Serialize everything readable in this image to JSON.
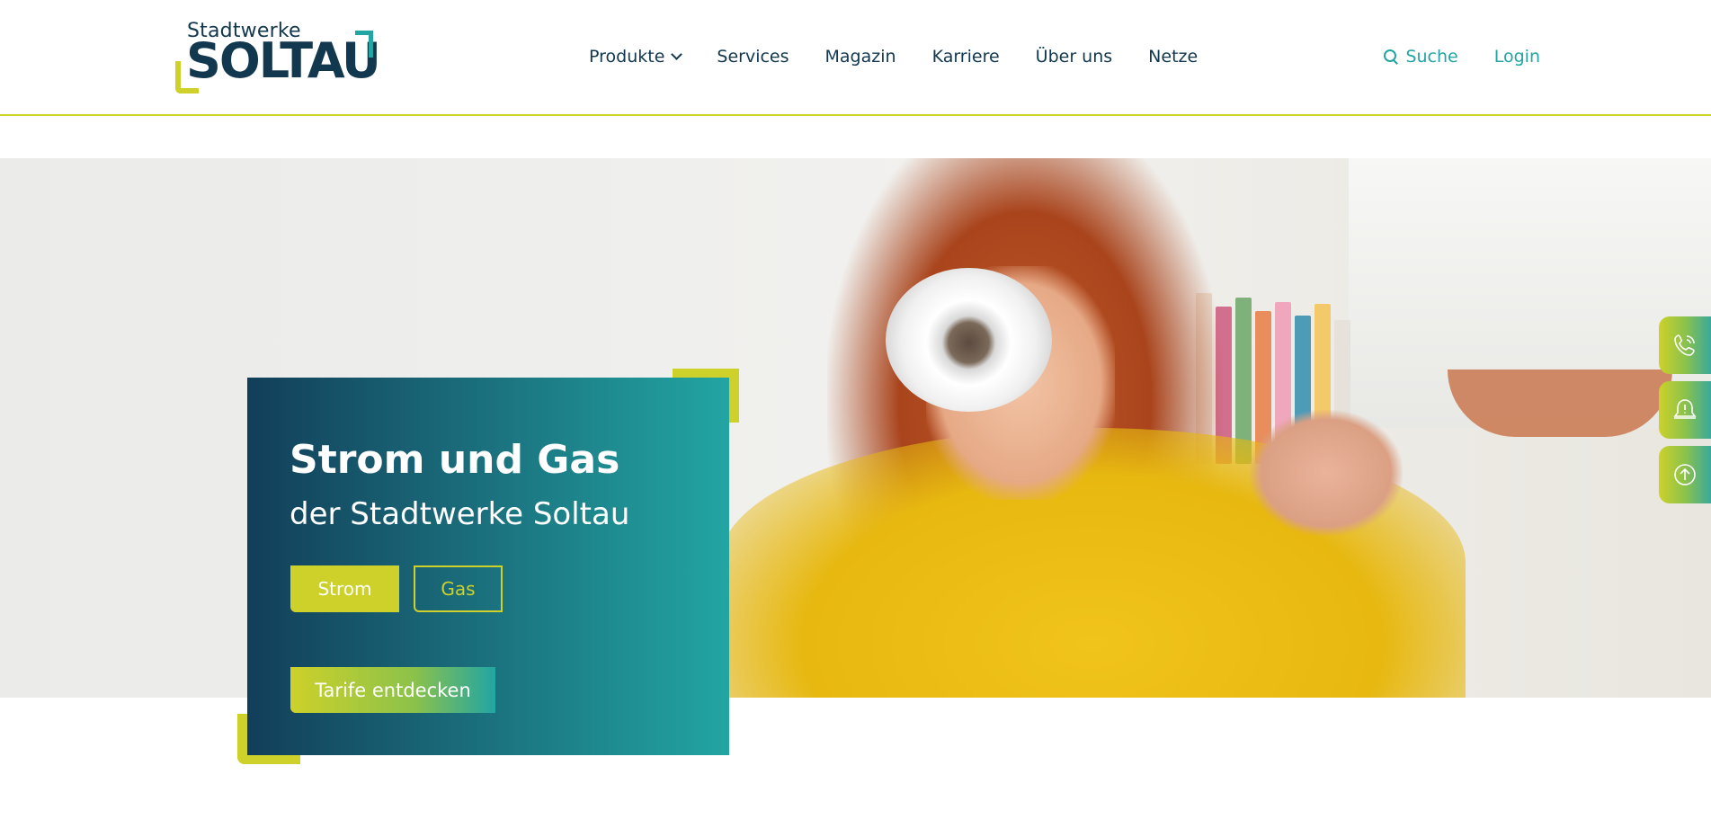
{
  "brand": {
    "line1": "Stadtwerke",
    "line2": "SOLTAU",
    "accent_yellow": "#cdd12a",
    "accent_teal": "#22a5a3",
    "navy": "#12384f"
  },
  "nav": {
    "items": [
      {
        "label": "Produkte",
        "has_dropdown": true
      },
      {
        "label": "Services"
      },
      {
        "label": "Magazin"
      },
      {
        "label": "Karriere"
      },
      {
        "label": "Über uns"
      },
      {
        "label": "Netze"
      }
    ]
  },
  "utility": {
    "search_label": "Suche",
    "login_label": "Login"
  },
  "hero": {
    "title": "Strom und Gas",
    "subtitle": "der Stadtwerke Soltau",
    "toggle": {
      "strom_label": "Strom",
      "gas_label": "Gas",
      "selected": "Strom"
    },
    "cta_label": "Tarife entdecken"
  },
  "side_buttons": [
    {
      "icon": "phone-icon"
    },
    {
      "icon": "alert-bell-icon"
    },
    {
      "icon": "arrow-up-icon"
    }
  ]
}
